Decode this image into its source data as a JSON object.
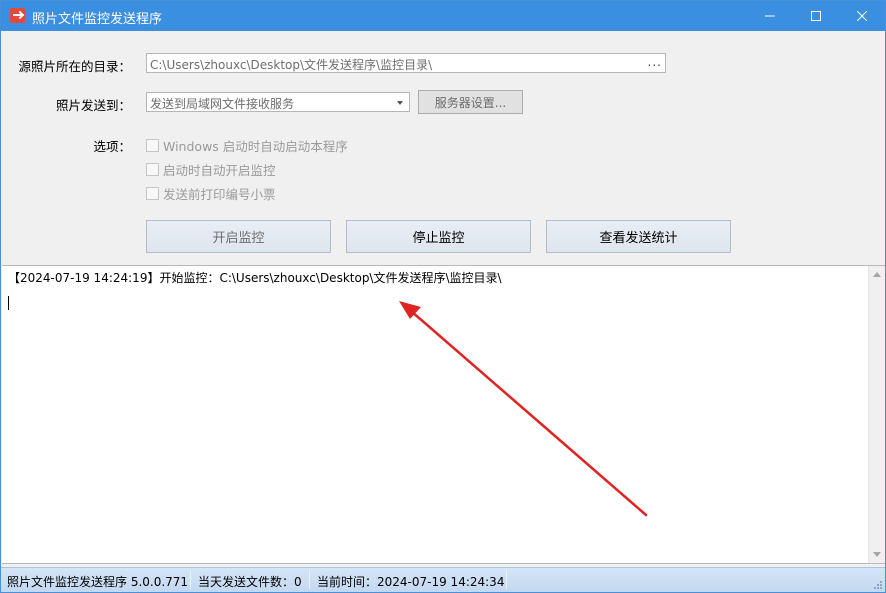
{
  "window": {
    "title": "照片文件监控发送程序",
    "titlebar_color": "#3b8fe0"
  },
  "form": {
    "dir_label": "源照片所在的目录：",
    "dir_value": "C:\\Users\\zhouxc\\Desktop\\文件发送程序\\监控目录\\",
    "dir_browse": "...",
    "send_label": "照片发送到：",
    "send_value": "发送到局域网文件接收服务",
    "server_button": "服务器设置...",
    "options_label": "选项：",
    "options": [
      {
        "label": "Windows 启动时自动启动本程序",
        "checked": false
      },
      {
        "label": "启动时自动开启监控",
        "checked": false
      },
      {
        "label": "发送前打印编号小票",
        "checked": false
      }
    ]
  },
  "actions": {
    "start": "开启监控",
    "stop": "停止监控",
    "stats": "查看发送统计"
  },
  "log": {
    "lines": [
      "【2024-07-19 14:24:19】开始监控：C:\\Users\\zhouxc\\Desktop\\文件发送程序\\监控目录\\"
    ]
  },
  "annotation": {
    "arrow_color": "#e02424",
    "icon": "red-arrow-icon"
  },
  "status": {
    "app_version": "照片文件监控发送程序 5.0.0.771",
    "sent_today": "当天发送文件数：0",
    "current_time": "当前时间：2024-07-19 14:24:34"
  }
}
